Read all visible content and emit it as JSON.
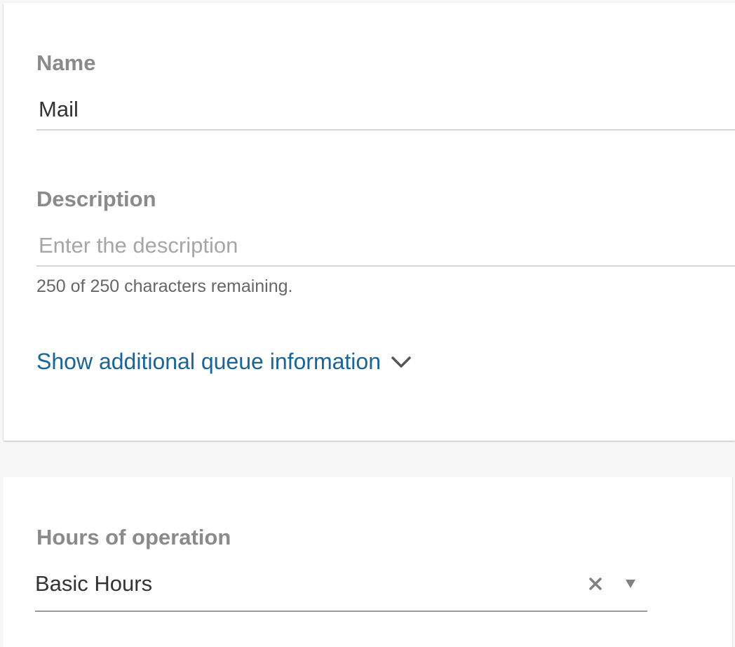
{
  "queue_details": {
    "name": {
      "label": "Name",
      "value": "Mail"
    },
    "description": {
      "label": "Description",
      "value": "",
      "placeholder": "Enter the description",
      "helper_text": "250 of 250 characters remaining."
    },
    "additional_info_toggle": {
      "label": "Show additional queue information",
      "icon": "chevron-down-icon"
    }
  },
  "hours_of_operation": {
    "label": "Hours of operation",
    "selected_value": "Basic Hours",
    "clear_icon": "close-icon",
    "dropdown_icon": "caret-down-icon"
  },
  "colors": {
    "link": "#1a6597",
    "label": "#8a8a8a",
    "value_text": "#333333",
    "placeholder": "#a6a6a6",
    "underline": "#d5d5d5",
    "page_background": "#f7f7f7",
    "card_background": "#ffffff"
  }
}
